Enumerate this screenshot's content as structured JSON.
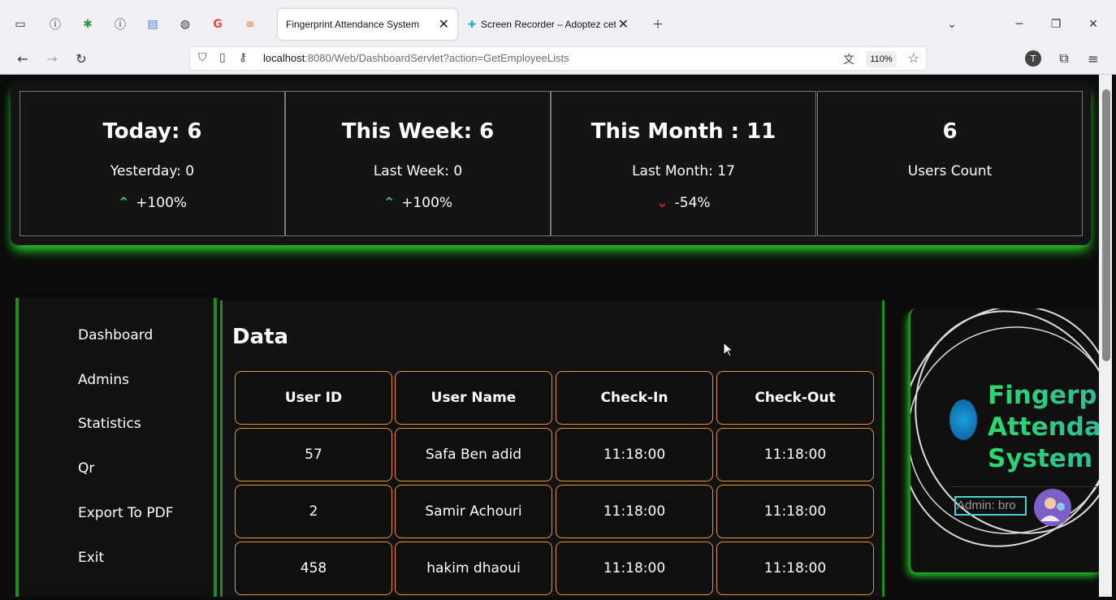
{
  "browser": {
    "active_tab_title": "Fingerprint Attendance System",
    "second_tab_title": "Screen Recorder – Adoptez cett",
    "url_host": "localhost",
    "url_rest": ":8080/Web/DashboardServlet?action=GetEmployeeLists",
    "zoom": "110%"
  },
  "stats": [
    {
      "big": "Today: 6",
      "sub": "Yesterday: 0",
      "trend": "up",
      "pct": "+100%"
    },
    {
      "big": "This Week: 6",
      "sub": "Last Week: 0",
      "trend": "up",
      "pct": "+100%"
    },
    {
      "big": "This Month : 11",
      "sub": "Last Month: 17",
      "trend": "down",
      "pct": "-54%"
    },
    {
      "big": "6",
      "sub": "Users Count",
      "trend": "",
      "pct": ""
    }
  ],
  "sidebar": {
    "items": [
      "Dashboard",
      "Admins",
      "Statistics",
      "Qr",
      "Export To PDF",
      "Exit"
    ]
  },
  "data": {
    "title": "Data",
    "columns": [
      "User ID",
      "User Name",
      "Check-In",
      "Check-Out"
    ],
    "rows": [
      [
        "57",
        "Safa Ben adid",
        "11:18:00",
        "11:18:00"
      ],
      [
        "2",
        "Samir Achouri",
        "11:18:00",
        "11:18:00"
      ],
      [
        "458",
        "hakim dhaoui",
        "11:18:00",
        "11:18:00"
      ]
    ]
  },
  "brand": {
    "line1": "Fingerpri",
    "line2": "Attendar",
    "line3": "System",
    "admin_label": "Admin: bro"
  },
  "colors": {
    "accent_green": "#28e028",
    "table_border": "#e8943a",
    "up": "#2bd96b",
    "down": "#e02020"
  }
}
